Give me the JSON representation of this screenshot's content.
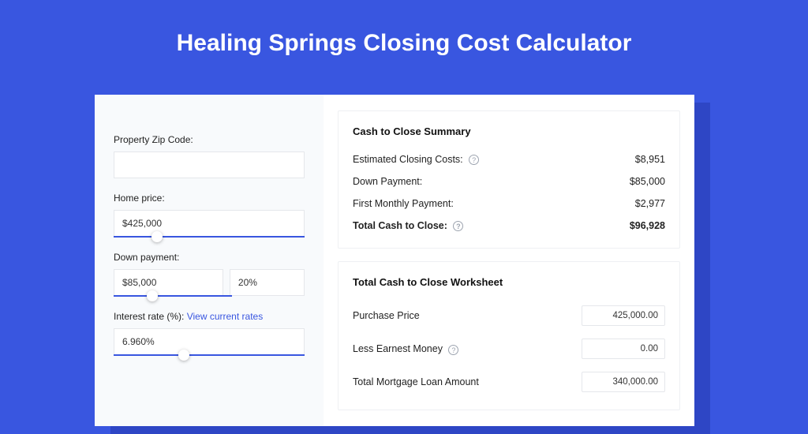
{
  "title": "Healing Springs Closing Cost Calculator",
  "form": {
    "zip_label": "Property Zip Code:",
    "zip_value": "",
    "home_price_label": "Home price:",
    "home_price_value": "$425,000",
    "down_payment_label": "Down payment:",
    "down_payment_value": "$85,000",
    "down_payment_pct": "20%",
    "interest_label": "Interest rate (%):",
    "interest_link": "View current rates",
    "interest_value": "6.960%"
  },
  "summary": {
    "title": "Cash to Close Summary",
    "rows": [
      {
        "label": "Estimated Closing Costs:",
        "value": "$8,951",
        "info": true
      },
      {
        "label": "Down Payment:",
        "value": "$85,000",
        "info": false
      },
      {
        "label": "First Monthly Payment:",
        "value": "$2,977",
        "info": false
      }
    ],
    "total_label": "Total Cash to Close:",
    "total_value": "$96,928"
  },
  "worksheet": {
    "title": "Total Cash to Close Worksheet",
    "rows": [
      {
        "label": "Purchase Price",
        "value": "425,000.00",
        "info": false
      },
      {
        "label": "Less Earnest Money",
        "value": "0.00",
        "info": true
      },
      {
        "label": "Total Mortgage Loan Amount",
        "value": "340,000.00",
        "info": false
      }
    ]
  }
}
